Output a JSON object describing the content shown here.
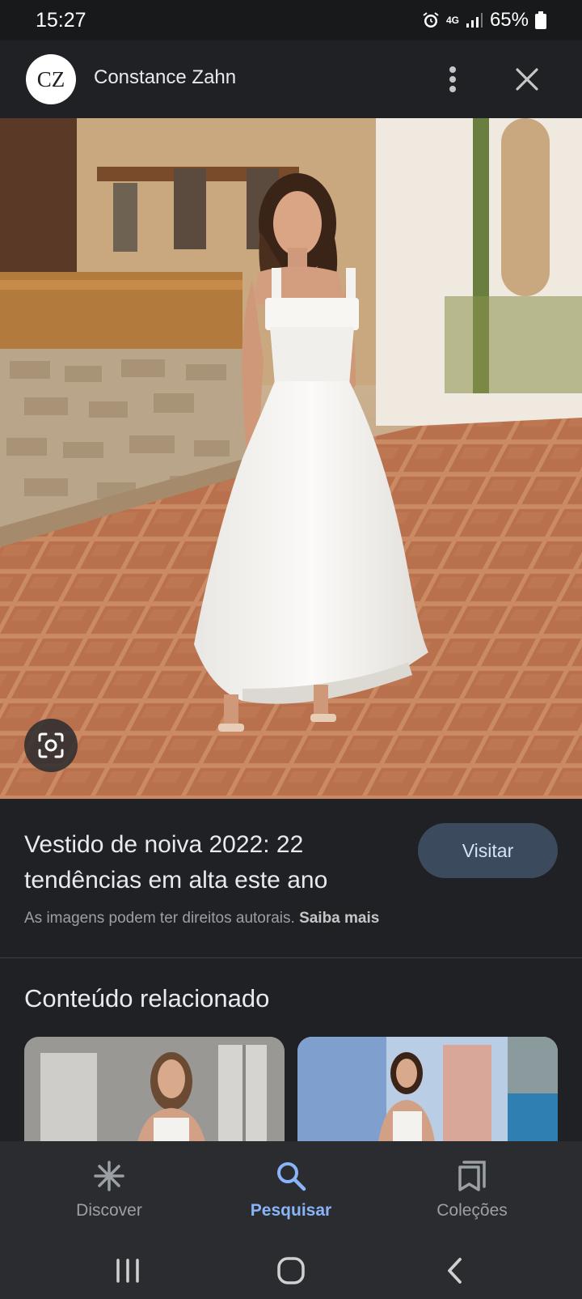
{
  "status_bar": {
    "time": "15:27",
    "network": "4G",
    "battery": "65%",
    "icons": [
      "alarm-icon",
      "network-4g-icon",
      "signal-icon",
      "battery-icon"
    ]
  },
  "header": {
    "avatar_text": "CZ",
    "source_name": "Constance Zahn",
    "icons": [
      "more-vert-icon",
      "close-icon"
    ]
  },
  "image": {
    "lens_icon": "lens-icon"
  },
  "result": {
    "title": "Vestido de noiva 2022: 22 tendências em alta este ano",
    "visit_label": "Visitar",
    "copyright_text": "As imagens podem ter direitos autorais.",
    "learn_more": "Saiba mais"
  },
  "related": {
    "title": "Conteúdo relacionado"
  },
  "bottom_nav": {
    "items": [
      {
        "label": "Discover",
        "icon": "discover-icon",
        "active": false
      },
      {
        "label": "Pesquisar",
        "icon": "search-icon",
        "active": true
      },
      {
        "label": "Coleções",
        "icon": "collections-icon",
        "active": false
      }
    ]
  },
  "system_nav": {
    "icons": [
      "recents-icon",
      "home-icon",
      "back-icon"
    ]
  },
  "colors": {
    "background": "#202124",
    "accent": "#8ab4f8",
    "visit_button": "#3c4a5e"
  }
}
